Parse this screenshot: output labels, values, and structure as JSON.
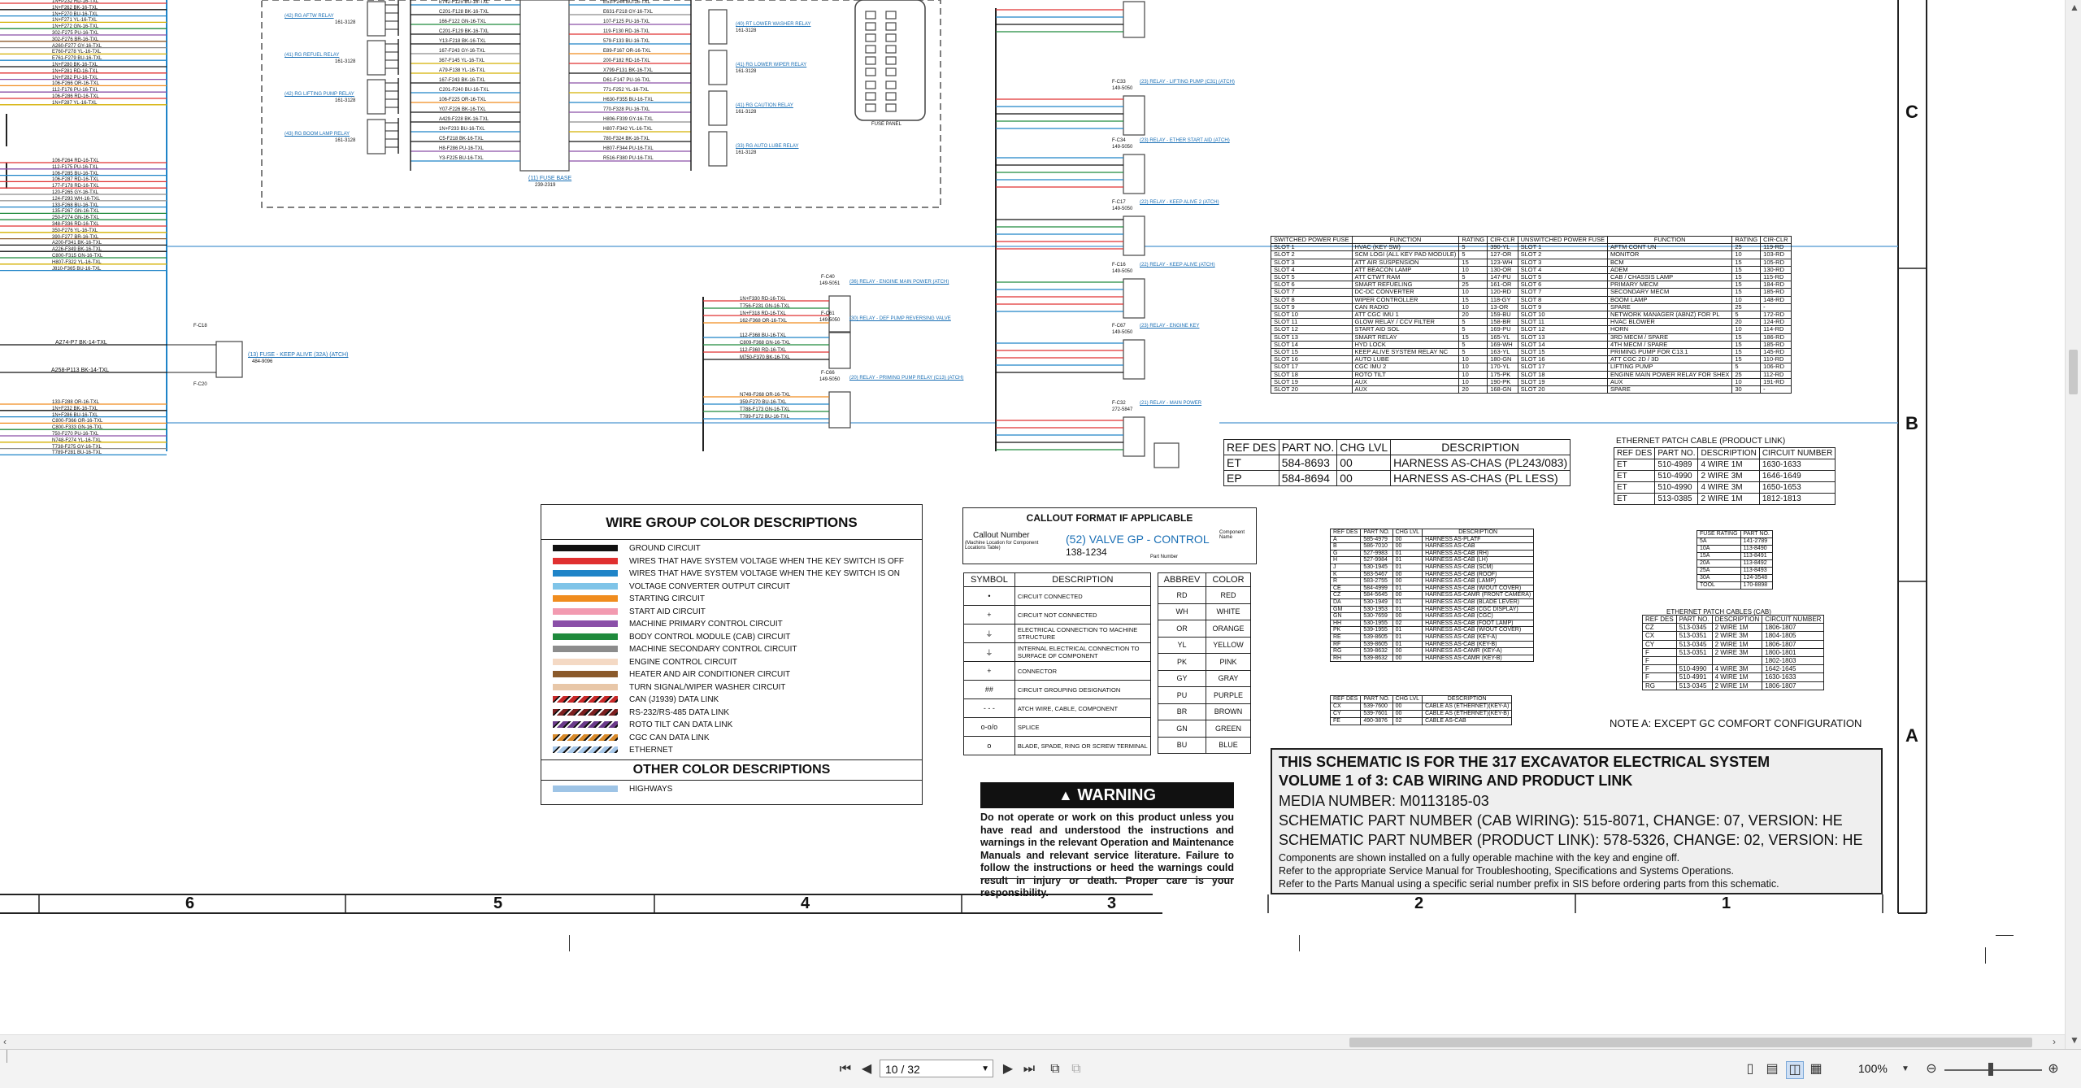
{
  "viewer": {
    "page_current": "10 / 32",
    "zoom": "100%"
  },
  "zones": {
    "columns": [
      "6",
      "5",
      "4",
      "3",
      "2",
      "1"
    ],
    "rows": [
      "C",
      "B",
      "A"
    ]
  },
  "left_harness": {
    "wires_top": [
      "1N+P232 RD-16-TXL",
      "1N+F262 BK-16-TXL",
      "1N+F270 BU-16-TXL",
      "1N+F271 YL-16-TXL",
      "1N+F272 GN-16-TXL",
      "302-F275 PU-16-TXL",
      "302-F276 BR-16-TXL",
      "A260-F277 GY-16-TXL",
      "E760-F278 YL-16-TXL",
      "E761-F279 BU-16-TXL",
      "1N+F280 BK-16-TXL",
      "1N+F281 RD-16-TXL",
      "1N+F282 PU-16-TXL",
      "106-F266 OR-16-TXL",
      "112-F176 PU-16-TXL",
      "106-F286 RD-16-TXL",
      "1N+F287 YL-16-TXL"
    ],
    "wires_mid": [
      "106-F264 RD-16-TXL",
      "112-F175 PU-16-TXL",
      "106-F285 BU-16-TXL",
      "106-F287 RD-16-TXL",
      "177-F178 RD-16-TXL",
      "120-F265 GY-16-TXL",
      "124-F293 WH-16-TXL",
      "133-F268 BU-16-TXL",
      "135-F267 GN-16-TXL",
      "250-F274 GN-16-TXL",
      "348-F336 RD-16-TXL",
      "350-F276 YL-16-TXL",
      "390-F277 BR-16-TXL",
      "A200-F341 BK-16-TXL",
      "A226-F349 BK-16-TXL",
      "C800-F315 GN-16-TXL",
      "H807-F322 YL-16-TXL",
      "J810-F365 BU-16-TXL"
    ],
    "wire_single_1": "A274-P7 BK-14-TXL",
    "wire_single_2": "A258-P113 BK-14-TXL",
    "fuse_label": "(13) FUSE - KEEP ALIVE (32A) (ATCH)",
    "fuse_part": "484-9096",
    "wires_bottom": [
      "133-F288 OR-16-TXL",
      "1N+F232 BK-16-TXL",
      "1N+F286 BU-16-TXL",
      "C800-F366 OR-16-TXL",
      "C800-F333 GN-16-TXL",
      "750-F270 PU-16-TXL",
      "N748-F274 YL-16-TXL",
      "T738-F275 GY-16-TXL",
      "T789-F281 BU-16-TXL"
    ]
  },
  "relays_left": [
    {
      "label": "(42) RG AFTW RELAY",
      "part": "161-3128"
    },
    {
      "label": "(41) RG REFUEL RELAY",
      "part": "161-3128"
    },
    {
      "label": "(42) RG LIFTING PUMP RELAY",
      "part": "161-3128"
    },
    {
      "label": "(43) RG BOOM LAMP RELAY",
      "part": "161-3128"
    }
  ],
  "fuse_base": {
    "label": "(11) FUSE BASE",
    "part": "239-2319",
    "wires_left": [
      "E742-F125 BU-16-TXL",
      "C201-F128 BK-16-TXL",
      "166-F122 GN-16-TXL",
      "C201-F129 BK-16-TXL",
      "Y13-F218 BK-16-TXL",
      "167-F243 GY-16-TXL",
      "367-F145 YL-16-TXL",
      "A79-F138 YL-16-TXL",
      "167-F243 BK-16-TXL",
      "C201-F240 BU-16-TXL",
      "106-F225 OR-16-TXL",
      "Y07-F226 BK-16-TXL",
      "A429-F228 BK-16-TXL",
      "1N+F233 BU-16-TXL",
      "C5-F218 BK-16-TXL",
      "H8-F286 PU-16-TXL",
      "Y3-F225 BU-16-TXL"
    ],
    "wires_right": [
      "E53-F244 BU-16-TXL",
      "E631-F218 GY-16-TXL",
      "107-F125 PU-16-TXL",
      "119-F130 RD-16-TXL",
      "579-F133 BU-16-TXL",
      "E89-F167 OR-16-TXL",
      "200-F182 RD-16-TXL",
      "X799-F131 BK-16-TXL",
      "D61-F147 PU-16-TXL",
      "771-F252 YL-16-TXL",
      "H630-F355 BU-16-TXL",
      "770-F328 PU-16-TXL",
      "H806-F339 GY-16-TXL",
      "H807-F342 YL-16-TXL",
      "780-F324 BK-16-TXL",
      "H807-F344 PU-16-TXL",
      "R516-F380 PU-16-TXL"
    ]
  },
  "relays_mid": [
    {
      "label": "(40) RT LOWER WASHER RELAY",
      "part": "161-3128"
    },
    {
      "label": "(41) RG LOWER WIPER RELAY",
      "part": "161-3128"
    },
    {
      "label": "(41) RG CAUTION RELAY",
      "part": "161-3128"
    },
    {
      "label": "(33) RG AUTO LUBE RELAY",
      "part": "161-3128"
    }
  ],
  "fuse_panel_label": "FUSE PANEL",
  "relays_center": [
    {
      "label": "(36) RELAY - ENGINE MAIN POWER (ATCH)",
      "ref": "F-C40",
      "part": "149-5051",
      "wires": [
        "1N+F330 RD-16-TXL",
        "T756-F231 GN-16-TXL",
        "1N+F318 RD-16-TXL",
        "162-F368 OR-16-TXL"
      ]
    },
    {
      "label": "(30) RELAY - DEF PUMP REVERSING VALVE",
      "ref": "F-C61",
      "part": "149-5050",
      "wires": [
        "112-F368 BU-16-TXL",
        "C809-F368 GN-16-TXL",
        "112-F360 RD-16-TXL",
        "M750-F370 BK-16-TXL"
      ]
    },
    {
      "label": "(20) RELAY - PRIMING PUMP RELAY (C13) (ATCH)",
      "ref": "F-C66",
      "part": "149-5050",
      "wires": [
        "N749-F268 OR-16-TXL",
        "359-F270 BU-16-TXL",
        "T788-F173 GN-16-TXL",
        "T789-F172 BU-16-TXL"
      ]
    }
  ],
  "relays_right": [
    {
      "label": "(23) RELAY - LIFTING PUMP (C31) (ATCH)",
      "ref": "F-C33",
      "part": "149-5050"
    },
    {
      "label": "(23) RELAY - ETHER START AID (ATCH)",
      "ref": "F-C34",
      "part": "149-5050"
    },
    {
      "label": "(22) RELAY - KEEP ALIVE 2 (ATCH)",
      "ref": "F-C17",
      "part": "149-5050"
    },
    {
      "label": "(22) RELAY - KEEP ALIVE (ATCH)",
      "ref": "F-C16",
      "part": "149-5050"
    },
    {
      "label": "(23) RELAY - ENGINE KEY",
      "ref": "F-C67",
      "part": "149-5050"
    },
    {
      "label": "(21) RELAY - MAIN POWER",
      "ref": "F-C32",
      "part": "272-5847"
    }
  ],
  "fuse_table": {
    "headers": [
      "SWITCHED POWER FUSE",
      "FUNCTION",
      "RATING",
      "CIR-CLR",
      "UNSWITCHED POWER FUSE",
      "FUNCTION",
      "RATING",
      "CIR-CLR"
    ],
    "rows": [
      [
        "SLOT 1",
        "HVAC (KEY SW)",
        "5",
        "390-YL",
        "SLOT 1",
        "AFTM CONT UN",
        "25",
        "119-RD"
      ],
      [
        "SLOT 2",
        "SCM LOGI (ALL KEY PAD MODULE)",
        "5",
        "127-OR",
        "SLOT 2",
        "MONITOR",
        "10",
        "103-RD"
      ],
      [
        "SLOT 3",
        "ATT AIR SUSPENSION",
        "15",
        "123-WH",
        "SLOT 3",
        "BCM",
        "15",
        "105-RD"
      ],
      [
        "SLOT 4",
        "ATT BEACON LAMP",
        "10",
        "130-OR",
        "SLOT 4",
        "ADEM",
        "15",
        "130-RD"
      ],
      [
        "SLOT 5",
        "ATT CTWT RAM",
        "5",
        "147-PU",
        "SLOT 5",
        "CAB / CHASSIS LAMP",
        "15",
        "115-RD"
      ],
      [
        "SLOT 6",
        "SMART REFUELING",
        "25",
        "161-OR",
        "SLOT 6",
        "PRIMARY MECM",
        "15",
        "184-RD"
      ],
      [
        "SLOT 7",
        "DC-DC CONVERTER",
        "10",
        "120-RD",
        "SLOT 7",
        "SECONDARY MECM",
        "15",
        "185-RD"
      ],
      [
        "SLOT 8",
        "WIPER CONTROLLER",
        "15",
        "118-GY",
        "SLOT 8",
        "BOOM LAMP",
        "10",
        "148-RD"
      ],
      [
        "SLOT 9",
        "CAN RADIO",
        "10",
        "13-OR",
        "SLOT 9",
        "SPARE",
        "25",
        "-"
      ],
      [
        "SLOT 10",
        "ATT CGC IMU 1",
        "20",
        "159-BU",
        "SLOT 10",
        "NETWORK MANAGER (ABNZ) FOR PL",
        "5",
        "172-RD"
      ],
      [
        "SLOT 11",
        "GLOW RELAY / CCV FILTER",
        "5",
        "158-BR",
        "SLOT 11",
        "HVAC BLOWER",
        "20",
        "124-RD"
      ],
      [
        "SLOT 12",
        "START AID SOL",
        "5",
        "169-PU",
        "SLOT 12",
        "HORN",
        "10",
        "114-RD"
      ],
      [
        "SLOT 13",
        "SMART RELAY",
        "15",
        "165-YL",
        "SLOT 13",
        "3RD MECM / SPARE",
        "15",
        "186-RD"
      ],
      [
        "SLOT 14",
        "HYD LOCK",
        "5",
        "169-WH",
        "SLOT 14",
        "4TH MECM / SPARE",
        "15",
        "185-RD"
      ],
      [
        "SLOT 15",
        "KEEP ALIVE SYSTEM RELAY NC",
        "5",
        "163-YL",
        "SLOT 15",
        "PRIMING PUMP FOR C13.1",
        "15",
        "145-RD"
      ],
      [
        "SLOT 16",
        "AUTO LUBE",
        "10",
        "180-GN",
        "SLOT 16",
        "ATT CGC 2D / 3D",
        "15",
        "110-RD"
      ],
      [
        "SLOT 17",
        "CGC IMU 2",
        "10",
        "170-YL",
        "SLOT 17",
        "LIFTING PUMP",
        "5",
        "106-RD"
      ],
      [
        "SLOT 18",
        "ROTO TILT",
        "10",
        "175-PK",
        "SLOT 18",
        "ENGINE MAIN POWER RELAY FOR SHEX",
        "25",
        "112-RD"
      ],
      [
        "SLOT 19",
        "AUX",
        "10",
        "190-PK",
        "SLOT 19",
        "AUX",
        "10",
        "191-RD"
      ],
      [
        "SLOT 20",
        "AUX",
        "20",
        "168-GN",
        "SLOT 20",
        "SPARE",
        "30",
        "-"
      ]
    ]
  },
  "harness_table": {
    "headers": [
      "REF DES",
      "PART NO.",
      "CHG LVL",
      "DESCRIPTION"
    ],
    "rows": [
      [
        "ET",
        "584-8693",
        "00",
        "HARNESS AS-CHAS (PL243/083)"
      ],
      [
        "EP",
        "584-8694",
        "00",
        "HARNESS AS-CHAS (PL LESS)"
      ]
    ]
  },
  "ethernet_table": {
    "title": "ETHERNET PATCH CABLE (PRODUCT LINK)",
    "headers": [
      "REF DES",
      "PART NO.",
      "DESCRIPTION",
      "CIRCUIT NUMBER"
    ],
    "rows": [
      [
        "ET",
        "510-4989",
        "4 WIRE 1M",
        "1630-1633"
      ],
      [
        "ET",
        "510-4990",
        "2 WIRE 3M",
        "1646-1649"
      ],
      [
        "ET",
        "510-4990",
        "4 WIRE 3M",
        "1650-1653"
      ],
      [
        "ET",
        "513-0385",
        "2 WIRE 1M",
        "1812-1813"
      ]
    ]
  },
  "cab_harness_table": {
    "headers": [
      "REF DES",
      "PART NO.",
      "CHG LVL",
      "DESCRIPTION"
    ],
    "rows": [
      [
        "A",
        "585-4979",
        "00",
        "HARNESS AS-PLATF"
      ],
      [
        "B",
        "586-7010",
        "00",
        "HARNESS AS-CAB"
      ],
      [
        "G",
        "527-9983",
        "01",
        "HARNESS AS-CAB (RH)"
      ],
      [
        "H",
        "527-9984",
        "01",
        "HARNESS AS-CAB (LH)"
      ],
      [
        "J",
        "530-1945",
        "01",
        "HARNESS AS-CAB (SCM)"
      ],
      [
        "K",
        "583-5467",
        "00",
        "HARNESS AS-CAB (ROOF)"
      ],
      [
        "R",
        "583-2755",
        "00",
        "HARNESS AS-CAB (LAMP)"
      ],
      [
        "CE",
        "584-4999",
        "01",
        "HARNESS AS-CAB (W/OUT COVER)"
      ],
      [
        "CZ",
        "584-5645",
        "00",
        "HARNESS AS-CAMR (FRONT CAMERA)"
      ],
      [
        "DA",
        "530-1949",
        "01",
        "HARNESS AS-CAB (BLADE LEVER)"
      ],
      [
        "GM",
        "530-1953",
        "01",
        "HARNESS AS-CAB (CGC DISPLAY)"
      ],
      [
        "GN",
        "530-7659",
        "00",
        "HARNESS AS-CAB (CGC)"
      ],
      [
        "HH",
        "530-1955",
        "02",
        "HARNESS AS-CAB (FOOT LAMP)"
      ],
      [
        "PK",
        "539-1955",
        "01",
        "HARNESS AS-CAB (W/OUT COVER)"
      ],
      [
        "RE",
        "539-8605",
        "01",
        "HARNESS AS-CAB (KEY-A)"
      ],
      [
        "RF",
        "539-8605",
        "01",
        "HARNESS AS-CAB (KEY-B)"
      ],
      [
        "RG",
        "539-8632",
        "00",
        "HARNESS AS-CAMR (KEY-A)"
      ],
      [
        "RH",
        "539-8632",
        "00",
        "HARNESS AS-CAMR (KEY-B)"
      ]
    ]
  },
  "cable_table": {
    "headers": [
      "REF DES",
      "PART NO.",
      "CHG LVL",
      "DESCRIPTION"
    ],
    "rows": [
      [
        "CX",
        "539-7600",
        "00",
        "CABLE AS (ETHERNET)(KEY-A)"
      ],
      [
        "CY",
        "539-7601",
        "00",
        "CABLE AS (ETHERNET)(KEY-B)"
      ],
      [
        "FE",
        "490-3876",
        "02",
        "CABLE AS-CAB"
      ]
    ]
  },
  "fuse_rating_table": {
    "headers": [
      "FUSE RATING",
      "PART NO."
    ],
    "rows": [
      [
        "5A",
        "141-2789"
      ],
      [
        "10A",
        "113-8490"
      ],
      [
        "15A",
        "113-8491"
      ],
      [
        "20A",
        "113-8492"
      ],
      [
        "25A",
        "113-8493"
      ],
      [
        "30A",
        "124-3548"
      ],
      [
        "TOOL",
        "170-8898"
      ]
    ]
  },
  "ethernet_cab_table": {
    "title": "ETHERNET PATCH CABLES (CAB)",
    "headers": [
      "REF DES",
      "PART NO.",
      "DESCRIPTION",
      "CIRCUIT NUMBER"
    ],
    "rows": [
      [
        "CZ",
        "513-0345",
        "2 WIRE 1M",
        "1806-1807"
      ],
      [
        "CX",
        "513-0351",
        "2 WIRE 3M",
        "1804-1805"
      ],
      [
        "CY",
        "513-0345",
        "2 WIRE 1M",
        "1806-1807"
      ],
      [
        "F",
        "513-0351",
        "2 WIRE 3M",
        "1800-1801"
      ],
      [
        "F",
        "",
        "",
        "1802-1803"
      ],
      [
        "F",
        "510-4990",
        "4 WIRE 3M",
        "1642-1645"
      ],
      [
        "F",
        "510-4991",
        "4 WIRE 1M",
        "1630-1633"
      ],
      [
        "RG",
        "513-0345",
        "2 WIRE 1M",
        "1806-1807"
      ]
    ]
  },
  "note_a": "NOTE A: EXCEPT GC COMFORT CONFIGURATION",
  "wire_colors": {
    "title": "WIRE GROUP COLOR DESCRIPTIONS",
    "items": [
      {
        "label": "GROUND CIRCUIT",
        "color": "#111111"
      },
      {
        "label": "WIRES THAT HAVE SYSTEM VOLTAGE WHEN THE KEY SWITCH IS OFF",
        "color": "#e03030"
      },
      {
        "label": "WIRES THAT HAVE SYSTEM VOLTAGE WHEN THE KEY SWITCH IS ON",
        "color": "#1f84c8"
      },
      {
        "label": "VOLTAGE CONVERTER OUTPUT CIRCUIT",
        "color": "#7fc4e8"
      },
      {
        "label": "STARTING CIRCUIT",
        "color": "#f08c1e"
      },
      {
        "label": "START AID CIRCUIT",
        "color": "#f29ab0"
      },
      {
        "label": "MACHINE PRIMARY CONTROL CIRCUIT",
        "color": "#8a4fa8"
      },
      {
        "label": "BODY CONTROL MODULE (CAB) CIRCUIT",
        "color": "#1f8a3c"
      },
      {
        "label": "MACHINE SECONDARY CONTROL CIRCUIT",
        "color": "#8c8c8c"
      },
      {
        "label": "ENGINE CONTROL CIRCUIT",
        "color": "#f4d9c4"
      },
      {
        "label": "HEATER AND AIR CONDITIONER CIRCUIT",
        "color": "#8b5a2b"
      },
      {
        "label": "TURN SIGNAL/WIPER WASHER CIRCUIT",
        "color": "#e8c7a8"
      },
      {
        "label": "CAN (J1939) DATA LINK",
        "color": "#c62828"
      },
      {
        "label": "RS-232/RS-485 DATA LINK",
        "color": "#7b1f1f"
      },
      {
        "label": "ROTO TILT CAN DATA LINK",
        "color": "#6a3a8a"
      },
      {
        "label": "CGC CAN DATA LINK",
        "color": "#d88a2a"
      },
      {
        "label": "ETHERNET",
        "color": "#a8c8e8"
      }
    ],
    "other_title": "OTHER COLOR DESCRIPTIONS",
    "other_items": [
      {
        "label": "HIGHWAYS",
        "color": "#9ec4e6"
      }
    ]
  },
  "callout": {
    "title": "CALLOUT FORMAT IF APPLICABLE",
    "callout_number": "Callout Number",
    "callout_sub": "(Machine Location for Component Locations Table)",
    "example": "(52) VALVE GP - CONTROL",
    "part_example": "138-1234",
    "component_name": "Component Name",
    "part_number": "Part Number"
  },
  "symbols": {
    "headers": [
      "SYMBOL",
      "DESCRIPTION",
      "ABBREV",
      "COLOR"
    ],
    "rows": [
      {
        "sym": "•",
        "desc": "CIRCUIT CONNECTED",
        "abbr": "RD",
        "color": "RED"
      },
      {
        "sym": "+",
        "desc": "CIRCUIT NOT CONNECTED",
        "abbr": "WH",
        "color": "WHITE"
      },
      {
        "sym": "⏚",
        "desc": "ELECTRICAL CONNECTION TO MACHINE STRUCTURE",
        "abbr": "OR",
        "color": "ORANGE"
      },
      {
        "sym": "⏚",
        "desc": "INTERNAL ELECTRICAL CONNECTION TO SURFACE OF COMPONENT",
        "abbr": "YL",
        "color": "YELLOW"
      },
      {
        "sym": "+",
        "desc": "CONNECTOR",
        "abbr": "PK",
        "color": "PINK"
      },
      {
        "sym": "##",
        "desc": "CIRCUIT GROUPING DESIGNATION",
        "abbr": "GY",
        "color": "GRAY"
      },
      {
        "sym": "- - -",
        "desc": "ATCH WIRE, CABLE, COMPONENT",
        "abbr": "PU",
        "color": "PURPLE"
      },
      {
        "sym": "o-o/o",
        "desc": "SPLICE",
        "abbr": "BR",
        "color": "BROWN"
      },
      {
        "sym": "o",
        "desc": "BLADE, SPADE, RING OR SCREW TERMINAL",
        "abbr": "GN",
        "color": "GREEN"
      },
      {
        "sym": "",
        "desc": "",
        "abbr": "BU",
        "color": "BLUE"
      }
    ]
  },
  "warning": {
    "title": "WARNING",
    "text": "Do not operate or work on this product unless you have read and understood the instructions and warnings in the relevant Operation and Maintenance Manuals and relevant service literature. Failure to follow the instructions or heed the warnings could result in injury or death. Proper care is your responsibility."
  },
  "title_block": {
    "line1": "THIS SCHEMATIC IS FOR THE 317 EXCAVATOR ELECTRICAL SYSTEM",
    "line2": "VOLUME 1 of 3: CAB WIRING AND PRODUCT LINK",
    "media": "MEDIA NUMBER: M0113185-03",
    "part_cab": "SCHEMATIC PART NUMBER (CAB WIRING): 515-8071, CHANGE: 07, VERSION: HE",
    "part_pl": "SCHEMATIC PART NUMBER (PRODUCT LINK): 578-5326, CHANGE: 02, VERSION: HE",
    "note1": "Components are shown installed on a fully operable machine with the key and engine off.",
    "note2": "Refer to the appropriate Service Manual for Troubleshooting, Specifications and Systems Operations.",
    "note3": "Refer to the Parts Manual using a specific serial number prefix in SIS before ordering parts from this schematic."
  },
  "colors": {
    "wire_blue": "#1f84c8",
    "wire_red": "#e03030",
    "wire_green": "#1f8a3c",
    "wire_black": "#111111",
    "link_blue": "#1a6fb5",
    "warning_black": "#111111"
  }
}
